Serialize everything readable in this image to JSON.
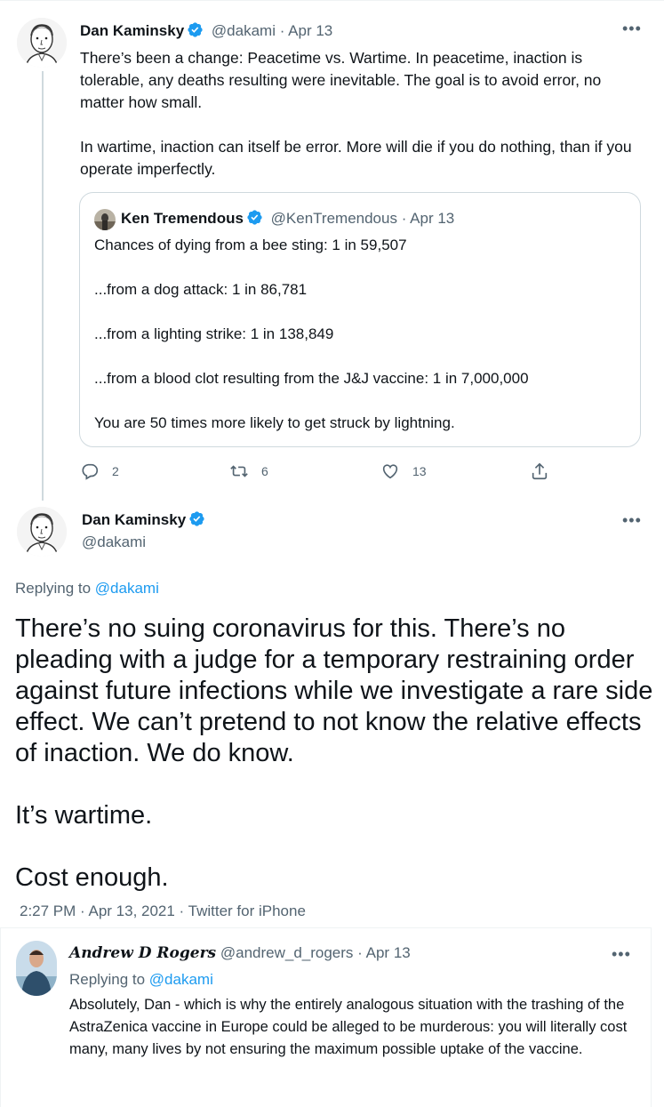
{
  "tweet1": {
    "author_name": "Dan Kaminsky",
    "handle": "@dakami",
    "separator": "·",
    "date": "Apr 13",
    "paragraphs": [
      "There’s been a change: Peacetime vs. Wartime. In peacetime, inaction is tolerable, any deaths resulting were inevitable. The goal is to avoid error, no matter how small.",
      "In wartime, inaction can itself be error.  More will die if you do nothing, than if you operate imperfectly."
    ],
    "more_icon": "more-icon",
    "quote": {
      "author_name": "Ken Tremendous",
      "handle": "@KenTremendous",
      "date": "Apr 13",
      "lines": [
        "Chances of dying from a bee sting: 1 in 59,507",
        "...from a dog attack: 1 in 86,781",
        "...from a lighting strike: 1 in 138,849",
        "...from a blood clot resulting from the J&J vaccine: 1 in 7,000,000",
        "You are 50 times more likely to get struck by lightning."
      ]
    },
    "actions": {
      "reply_count": "2",
      "retweet_count": "6",
      "like_count": "13"
    }
  },
  "tweet2": {
    "author_name": "Dan Kaminsky",
    "handle": "@dakami",
    "replying_prefix": "Replying to ",
    "replying_to": "@dakami",
    "paragraphs": [
      "There’s no suing coronavirus for this. There’s no pleading with a judge for a temporary restraining order against future infections while we investigate a rare side effect. We can’t pretend to not know the relative effects of inaction. We do know.",
      "It’s wartime.",
      "Cost enough."
    ],
    "timestamp": "2:27 PM · Apr 13, 2021 · Twitter for iPhone"
  },
  "reply": {
    "author_name": "Andrew D Rogers",
    "handle": "@andrew_d_rogers",
    "date": "Apr 13",
    "replying_prefix": "Replying to ",
    "replying_to": "@dakami",
    "text": "Absolutely, Dan - which is why the entirely analogous situation with the trashing of the AstraZenica vaccine in Europe could be alleged to be murderous: you will literally cost many, many lives by not ensuring the maximum possible uptake of the vaccine."
  },
  "colors": {
    "verified": "#1d9bf0",
    "link": "#1d9bf0",
    "muted": "#536471",
    "border": "#cfd9de"
  }
}
